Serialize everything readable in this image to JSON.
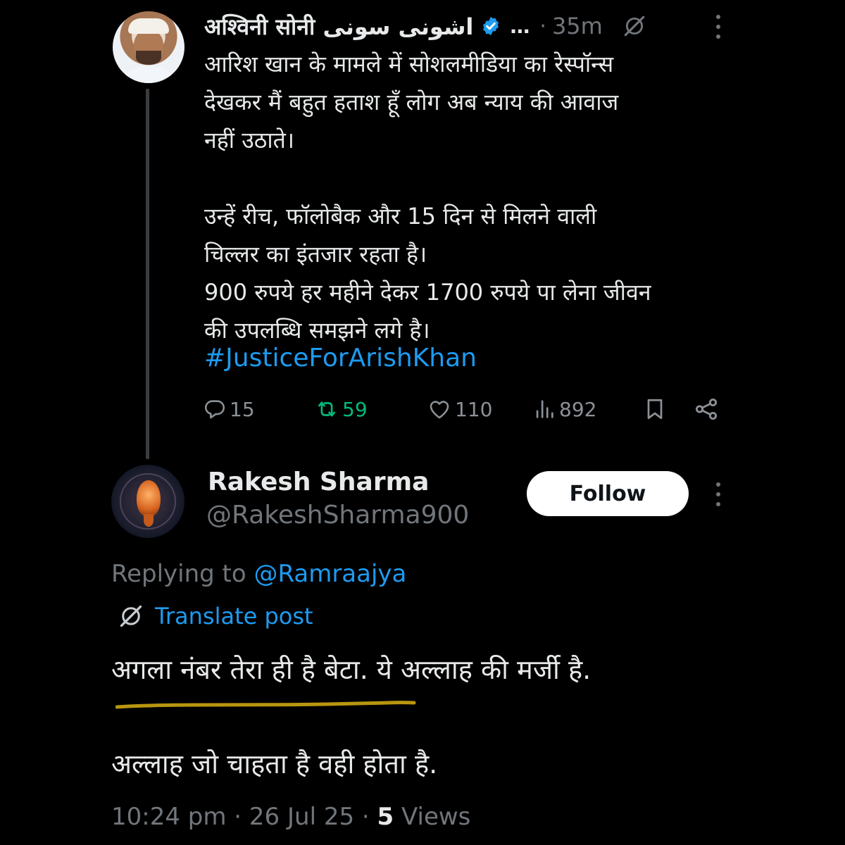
{
  "post": {
    "author_name": "अश्विनी सोनी اشونی سونی",
    "ellipsis": "…",
    "separator": "·",
    "time_ago": "35m",
    "body": "आरिश खान के मामले में सोशलमीडिया का रेस्पॉन्स\nदेखकर मैं बहुत हताश हूँ लोग अब न्याय की आवाज\nनहीं उठाते।\n\nउन्हें रीच, फॉलोबैक और 15 दिन से मिलने वाली\nचिल्लर का इंतजार रहता है।\n900 रुपये हर महीने देकर 1700 रुपये पा लेना जीवन\nकी उपलब्धि समझने लगे है।",
    "hashtag": "#JusticeForArishKhan",
    "stats": {
      "replies": "15",
      "reposts": "59",
      "likes": "110",
      "views": "892"
    },
    "colors": {
      "repost": "#00ba7c",
      "link": "#1d9bf0",
      "verified": "#1d9bf0"
    }
  },
  "reply": {
    "author_name": "Rakesh Sharma",
    "handle": "@RakeshSharma900",
    "follow_label": "Follow",
    "replying_prefix": "Replying to ",
    "replying_to": "@Ramraajya",
    "translate_label": "Translate post",
    "line1": "अगला नंबर तेरा ही है बेटा. ये अल्लाह की मर्जी है.",
    "line2": "अल्लाह जो चाहता है वही होता है.",
    "timestamp": "10:24 pm · 26 Jul 25 · ",
    "views_count": "5",
    "views_label": " Views",
    "underline_color": "#b8960f"
  },
  "icons": {
    "verified": "verified-badge-icon",
    "grok": "grok-icon",
    "more": "more-vertical-icon",
    "reply": "reply-icon",
    "repost": "repost-icon",
    "like": "heart-icon",
    "views": "views-icon",
    "bookmark": "bookmark-icon",
    "share": "share-icon"
  }
}
